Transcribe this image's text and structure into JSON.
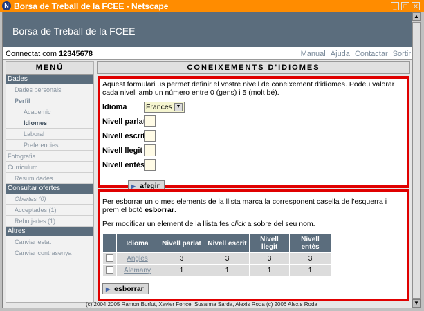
{
  "window": {
    "title": "Borsa de Treball de la FCEE - Netscape"
  },
  "header": {
    "title": "Borsa de Treball de la FCEE"
  },
  "userbar": {
    "connected_label": "Connectat com ",
    "user_id": "12345678",
    "links": [
      "Manual",
      "Ajuda",
      "Contactar",
      "Sortir"
    ]
  },
  "menu": {
    "title": "MENÚ",
    "sections": [
      {
        "label": "Dades",
        "items": [
          {
            "label": "Dades personals",
            "level": 1
          },
          {
            "label": "Perfil",
            "level": 1,
            "style": "bold"
          },
          {
            "label": "Academic",
            "level": 2
          },
          {
            "label": "Idiomes",
            "level": 2,
            "style": "selected"
          },
          {
            "label": "Laboral",
            "level": 2
          },
          {
            "label": "Preferencies",
            "level": 2
          },
          {
            "label": "Fotografia",
            "level": 0
          },
          {
            "label": "Curriculum",
            "level": 0
          },
          {
            "label": "Resum dades",
            "level": 1
          }
        ]
      },
      {
        "label": "Consultar ofertes",
        "items": [
          {
            "label": "Obertes (0)",
            "level": 1,
            "style": "italic"
          },
          {
            "label": "Acceptades (1)",
            "level": 1
          },
          {
            "label": "Rebutjades (1)",
            "level": 1
          }
        ]
      },
      {
        "label": "Altres",
        "items": [
          {
            "label": "Canviar estat",
            "level": 1
          },
          {
            "label": "Canviar contrasenya",
            "level": 1
          }
        ]
      }
    ]
  },
  "content": {
    "title": "CONEIXEMENTS D'IDIOMES",
    "form": {
      "intro": "Aquest formulari us permet definir el vostre nivell de coneixement d'idiomes. Podeu valorar cada nivell amb un número entre 0 (gens) i 5 (molt bé).",
      "idioma_label": "Idioma",
      "idioma_value": "Frances",
      "fields": [
        {
          "label": "Nivell parlat",
          "value": ""
        },
        {
          "label": "Nivell escrit",
          "value": ""
        },
        {
          "label": "Nivell llegit",
          "value": ""
        },
        {
          "label": "Nivell entès",
          "value": ""
        }
      ],
      "add_button": "afegir"
    },
    "list": {
      "intro1_a": "Per esborrar un o mes elements de la llista marca la corresponent casella de l'esquerra i prem el botó ",
      "intro1_b": "esborrar",
      "intro1_c": ".",
      "intro2_a": "Per modificar un element de la llista fes ",
      "intro2_b": "click",
      "intro2_c": " a sobre del seu nom.",
      "columns": [
        "Idioma",
        "Nivell parlat",
        "Nivell escrit",
        "Nivell llegit",
        "Nivell entès"
      ],
      "rows": [
        {
          "idioma": "Angles",
          "parlat": "3",
          "escrit": "3",
          "llegit": "3",
          "entes": "3"
        },
        {
          "idioma": "Alemany",
          "parlat": "1",
          "escrit": "1",
          "llegit": "1",
          "entes": "1"
        }
      ],
      "delete_button": "esborrar"
    }
  },
  "footer": {
    "text": "(c) 2004,2005 Ramon Burfut, Xavier Fonce, Susanna Sarda, Alexis Roda (c) 2006 Alexis Roda"
  }
}
